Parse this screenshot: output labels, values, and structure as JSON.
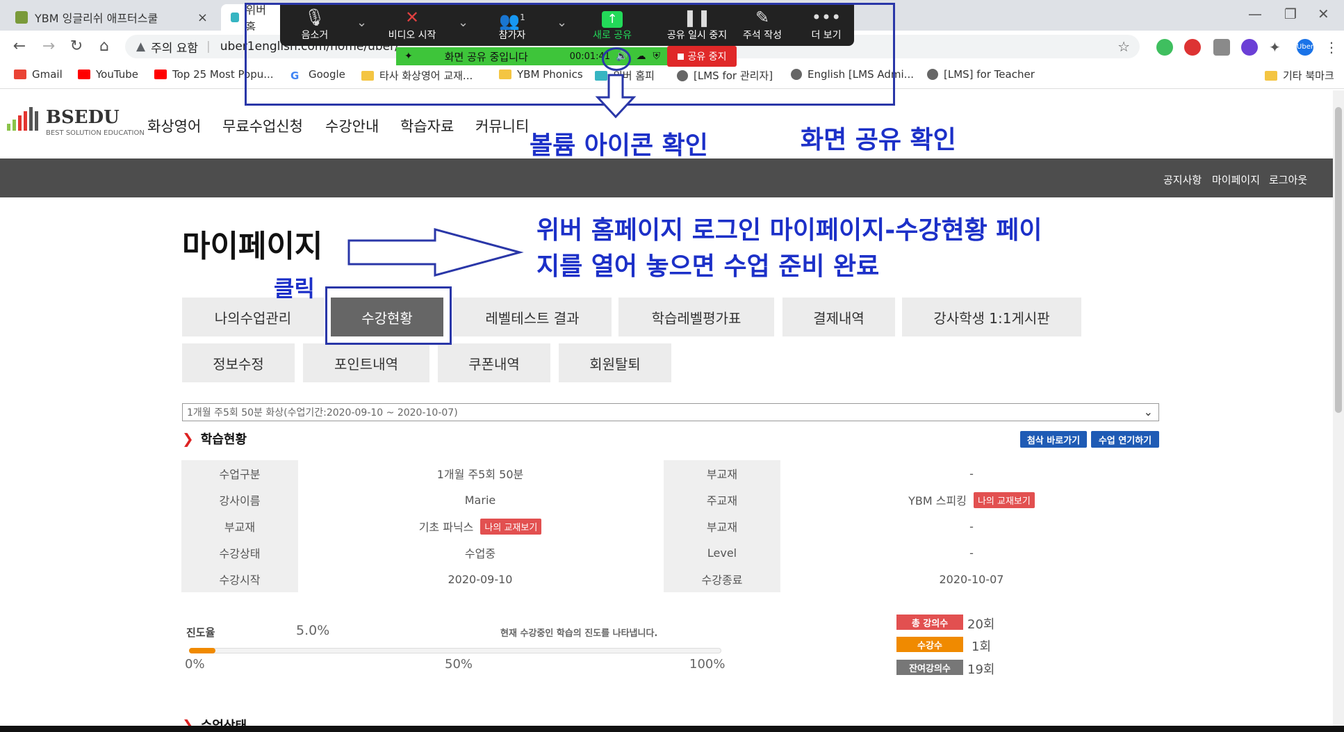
{
  "browser": {
    "tabs": [
      {
        "title": "YBM 잉글리쉬 애프터스쿨",
        "close": "×"
      },
      {
        "title": "위버 홈"
      }
    ],
    "nav": {
      "back": "←",
      "forward": "→",
      "reload": "↻",
      "home": "⌂"
    },
    "omnibox": {
      "warning_label": "주의 요함",
      "url": "uber1english.com/home/uber/"
    },
    "bookmarks": [
      "Gmail",
      "YouTube",
      "Top 25 Most Popu...",
      "Google",
      "타사 화상영어 교재...",
      "YBM Phonics",
      "위버 홈피",
      "[LMS for 관리자]",
      "English [LMS Admi...",
      "[LMS] for Teacher",
      "기타 북마크"
    ],
    "profile": "Uber"
  },
  "zoom": {
    "buttons": [
      {
        "label": "음소거",
        "icon": "microphone-icon"
      },
      {
        "label": "비디오 시작",
        "icon": "video-off-icon"
      },
      {
        "label": "참가자",
        "icon": "participants-icon",
        "count": "1"
      },
      {
        "label": "새로 공유",
        "icon": "share-screen-icon"
      },
      {
        "label": "공유 일시 중지",
        "icon": "pause-icon"
      },
      {
        "label": "주석 작성",
        "icon": "pencil-icon"
      },
      {
        "label": "더 보기",
        "icon": "more-icon"
      }
    ],
    "sharing_status": "화면 공유 중입니다",
    "timer": "00:01:41",
    "stop_share": "공유 중지"
  },
  "site": {
    "logo": {
      "name": "BSEDU",
      "tagline": "BEST SOLUTION EDUCATION"
    },
    "menu": [
      "화상영어",
      "무료수업신청",
      "수강안내",
      "학습자료",
      "커뮤니티"
    ],
    "top_links": [
      "공지사항",
      "마이페이지",
      "로그아웃"
    ]
  },
  "page": {
    "title": "마이페이지",
    "tabs_row1": [
      "나의수업관리",
      "수강현황",
      "레벨테스트 결과",
      "학습레벨평가표",
      "결제내역",
      "강사학생 1:1게시판"
    ],
    "tabs_row2": [
      "정보수정",
      "포인트내역",
      "쿠폰내역",
      "회원탈퇴"
    ],
    "course_select": "1개월 주5회 50분 화상(수업기간:2020-09-10 ~ 2020-10-07)",
    "study_status_title": "학습현황",
    "action_buttons": [
      "첨삭 바로가기",
      "수업 연기하기"
    ],
    "info_left": [
      {
        "label": "수업구분",
        "value": "1개월 주5회 50분"
      },
      {
        "label": "강사이름",
        "value": "Marie"
      },
      {
        "label": "부교재",
        "value": "기초 파닉스",
        "badge": "나의 교재보기"
      },
      {
        "label": "수강상태",
        "value": "수업중"
      },
      {
        "label": "수강시작",
        "value": "2020-09-10"
      }
    ],
    "info_right": [
      {
        "label": "부교재",
        "value": "-"
      },
      {
        "label": "주교재",
        "value": "YBM 스피킹",
        "badge": "나의 교재보기"
      },
      {
        "label": "부교재",
        "value": "-"
      },
      {
        "label": "Level",
        "value": "-"
      },
      {
        "label": "수강종료",
        "value": "2020-10-07"
      }
    ],
    "progress": {
      "label": "진도율",
      "value_text": "5.0%",
      "value": 0.05,
      "description": "현재 수강중인 학습의 진도를 나타냅니다.",
      "ticks": [
        "0%",
        "50%",
        "100%"
      ]
    },
    "stats": [
      {
        "label": "총 강의수",
        "value": "20회",
        "color": "#e25050"
      },
      {
        "label": "수강수",
        "value": "1회",
        "color": "#f08a00"
      },
      {
        "label": "잔여강의수",
        "value": "19회",
        "color": "#777777"
      }
    ],
    "next_section": "수업상태"
  },
  "annotations": {
    "volume_check": "볼륨 아이콘 확인",
    "share_check": "화면 공유 확인",
    "instruction_line1": "위버 홈페이지 로그인 마이페이지-수강현황 페이",
    "instruction_line2": "지를 열어 놓으면 수업 준비 완료",
    "click": "클릭"
  },
  "colors": {
    "annotation": "#1c30c8",
    "zoom_green": "#23d959",
    "stop_red": "#e02828"
  }
}
